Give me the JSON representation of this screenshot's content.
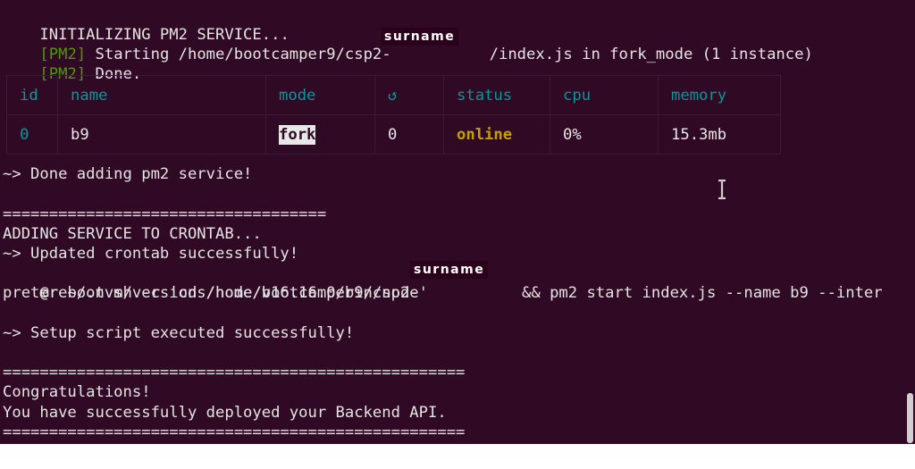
{
  "terminal": {
    "line_init": "INITIALIZING PM2 SERVICE...",
    "pm2_tag_1": "[PM2]",
    "starting_prefix": " Starting /home/bootcamper9/csp2-",
    "starting_suffix": "/index.js in fork_mode (1 instance)",
    "pm2_tag_2": "[PM2]",
    "done": " Done.",
    "redaction_label": "surname",
    "table": {
      "headers": [
        "id",
        "name",
        "mode",
        "↺",
        "status",
        "cpu",
        "memory"
      ],
      "row": {
        "id": "0",
        "name": "b9",
        "mode": "fork",
        "restarts": "0",
        "status": "online",
        "cpu": "0%",
        "memory": "15.3mb"
      }
    },
    "done_adding": "~> Done adding pm2 service!",
    "separator_short": "===================================",
    "adding_service": "ADDING SERVICE TO CRONTAB...",
    "updated_crontab": "~> Updated crontab successfully!",
    "reboot_prefix": "@reboot sh -c 'cd /home/bootcamper9/csp2-",
    "reboot_suffix": " && pm2 start index.js --name b9 --inter",
    "reboot_wrap": "preter ~/.nvm/versions/node/v16.16.0/bin/node'",
    "setup_done": "~> Setup script executed successfully!",
    "separator_long": "==================================================",
    "congrats": "Congratulations!",
    "deployed": "You have successfully deployed your Backend API.",
    "separator_long_2": "=================================================="
  },
  "colors": {
    "background": "#300924",
    "text": "#e8e8e8",
    "pm2_tag": "#4e9a06",
    "table_header": "#06989a",
    "status_online": "#c4a000"
  },
  "icons": {
    "cursor": "text-ibeam-cursor"
  }
}
